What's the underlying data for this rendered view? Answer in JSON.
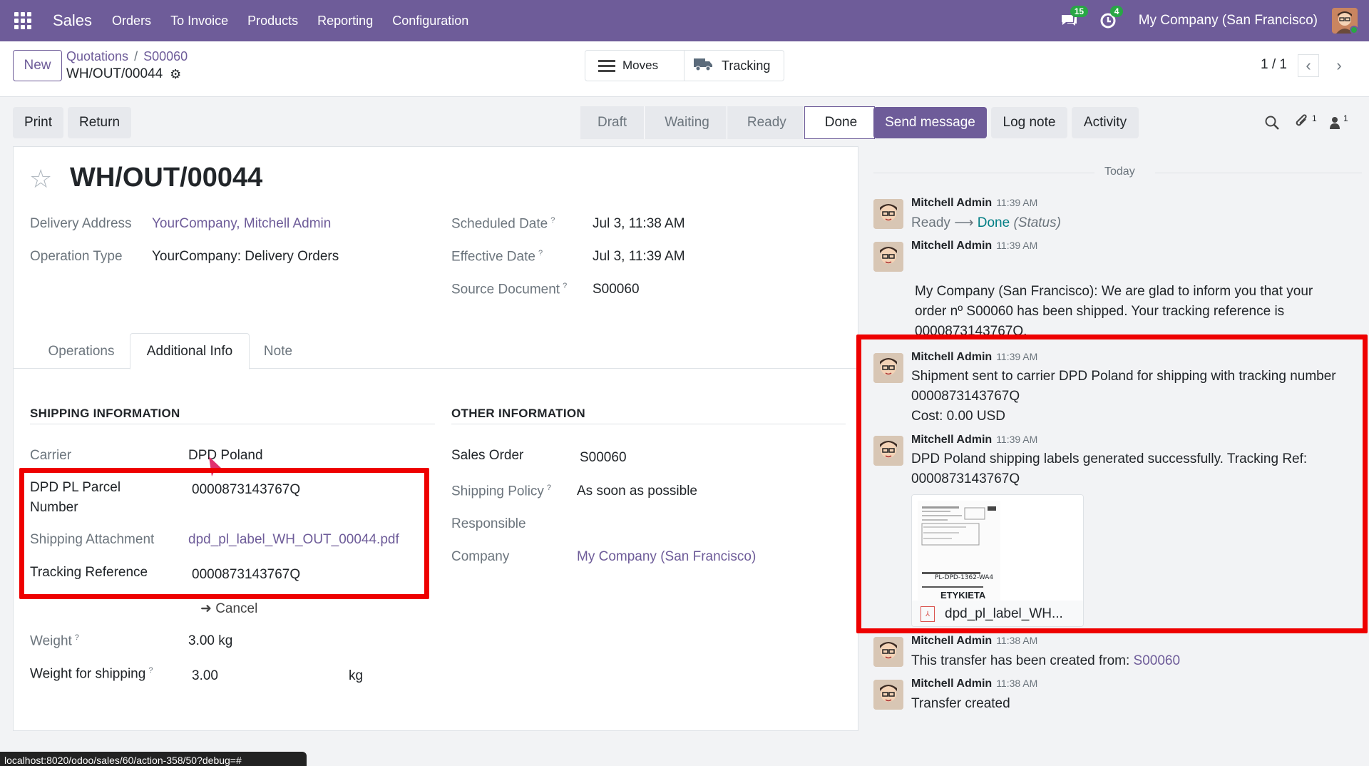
{
  "topbar": {
    "app_name": "Sales",
    "menu": [
      "Orders",
      "To Invoice",
      "Products",
      "Reporting",
      "Configuration"
    ],
    "messages_badge": "15",
    "activities_badge": "4",
    "company": "My Company (San Francisco)"
  },
  "control": {
    "new_label": "New",
    "breadcrumb_quotations": "Quotations",
    "breadcrumb_sep": "/",
    "breadcrumb_order": "S00060",
    "record_name": "WH/OUT/00044",
    "moves_label": "Moves",
    "tracking_label": "Tracking",
    "pager": "1 / 1"
  },
  "actions": {
    "print": "Print",
    "return": "Return",
    "statuses": [
      "Draft",
      "Waiting",
      "Ready",
      "Done"
    ],
    "active_status": "Done",
    "send_message": "Send message",
    "log_note": "Log note",
    "activity": "Activity",
    "attachments_count": "1",
    "followers_count": "1"
  },
  "form": {
    "title": "WH/OUT/00044",
    "delivery_address_label": "Delivery Address",
    "delivery_address": "YourCompany, Mitchell Admin",
    "operation_type_label": "Operation Type",
    "operation_type": "YourCompany: Delivery Orders",
    "scheduled_date_label": "Scheduled Date",
    "scheduled_date": "Jul 3, 11:38 AM",
    "effective_date_label": "Effective Date",
    "effective_date": "Jul 3, 11:39 AM",
    "source_document_label": "Source Document",
    "source_document": "S00060",
    "help_mark": "?",
    "tabs": [
      "Operations",
      "Additional Info",
      "Note"
    ],
    "shipping_header": "Shipping Information",
    "carrier_label": "Carrier",
    "carrier": "DPD Poland",
    "parcel_label_1": "DPD PL Parcel",
    "parcel_label_2": "Number",
    "parcel_number": "0000873143767Q",
    "attachment_label": "Shipping Attachment",
    "attachment": "dpd_pl_label_WH_OUT_00044.pdf",
    "tracking_ref_label": "Tracking Reference",
    "tracking_ref": "0000873143767Q",
    "cancel_label": "Cancel",
    "weight_label": "Weight",
    "weight": "3.00 kg",
    "weight_shipping_label": "Weight for shipping",
    "weight_shipping": "3.00",
    "weight_unit": "kg",
    "other_header": "Other Information",
    "sales_order_label": "Sales Order",
    "sales_order": "S00060",
    "shipping_policy_label": "Shipping Policy",
    "shipping_policy": "As soon as possible",
    "responsible_label": "Responsible",
    "company_label": "Company",
    "company": "My Company (San Francisco)"
  },
  "chatter": {
    "today": "Today",
    "m1_author": "Mitchell Admin",
    "m1_time": "11:39 AM",
    "m1_from": "Ready",
    "m1_to": "Done",
    "m1_field": "(Status)",
    "m2_author": "Mitchell Admin",
    "m2_time": "11:39 AM",
    "m2_line1": "My Company (San Francisco): We are glad to inform you that your",
    "m2_line2": "order nº S00060 has been shipped. Your tracking reference is",
    "m2_line3": "0000873143767Q.",
    "m3_author": "Mitchell Admin",
    "m3_time": "11:39 AM",
    "m3_line1": "Shipment sent to carrier DPD Poland for shipping with tracking number",
    "m3_line2": "0000873143767Q",
    "m3_line3": "Cost: 0.00 USD",
    "m4_author": "Mitchell Admin",
    "m4_time": "11:39 AM",
    "m4_line1": "DPD Poland shipping labels generated successfully. Tracking Ref:",
    "m4_line2": "0000873143767Q",
    "m4_attachment": "dpd_pl_label_WH...",
    "m4_thumb_text": "ETYKIETA",
    "m4_thumb_code": "PL-DPD-1362-WA4",
    "m5_author": "Mitchell Admin",
    "m5_time": "11:38 AM",
    "m5_text": "This transfer has been created from:",
    "m5_link": "S00060",
    "m6_author": "Mitchell Admin",
    "m6_time": "11:38 AM",
    "m6_text": "Transfer created"
  },
  "statusbar": {
    "url": "localhost:8020/odoo/sales/60/action-358/50?debug=#"
  },
  "colors": {
    "brand": "#6e5c99",
    "highlight": "#ee0000"
  }
}
